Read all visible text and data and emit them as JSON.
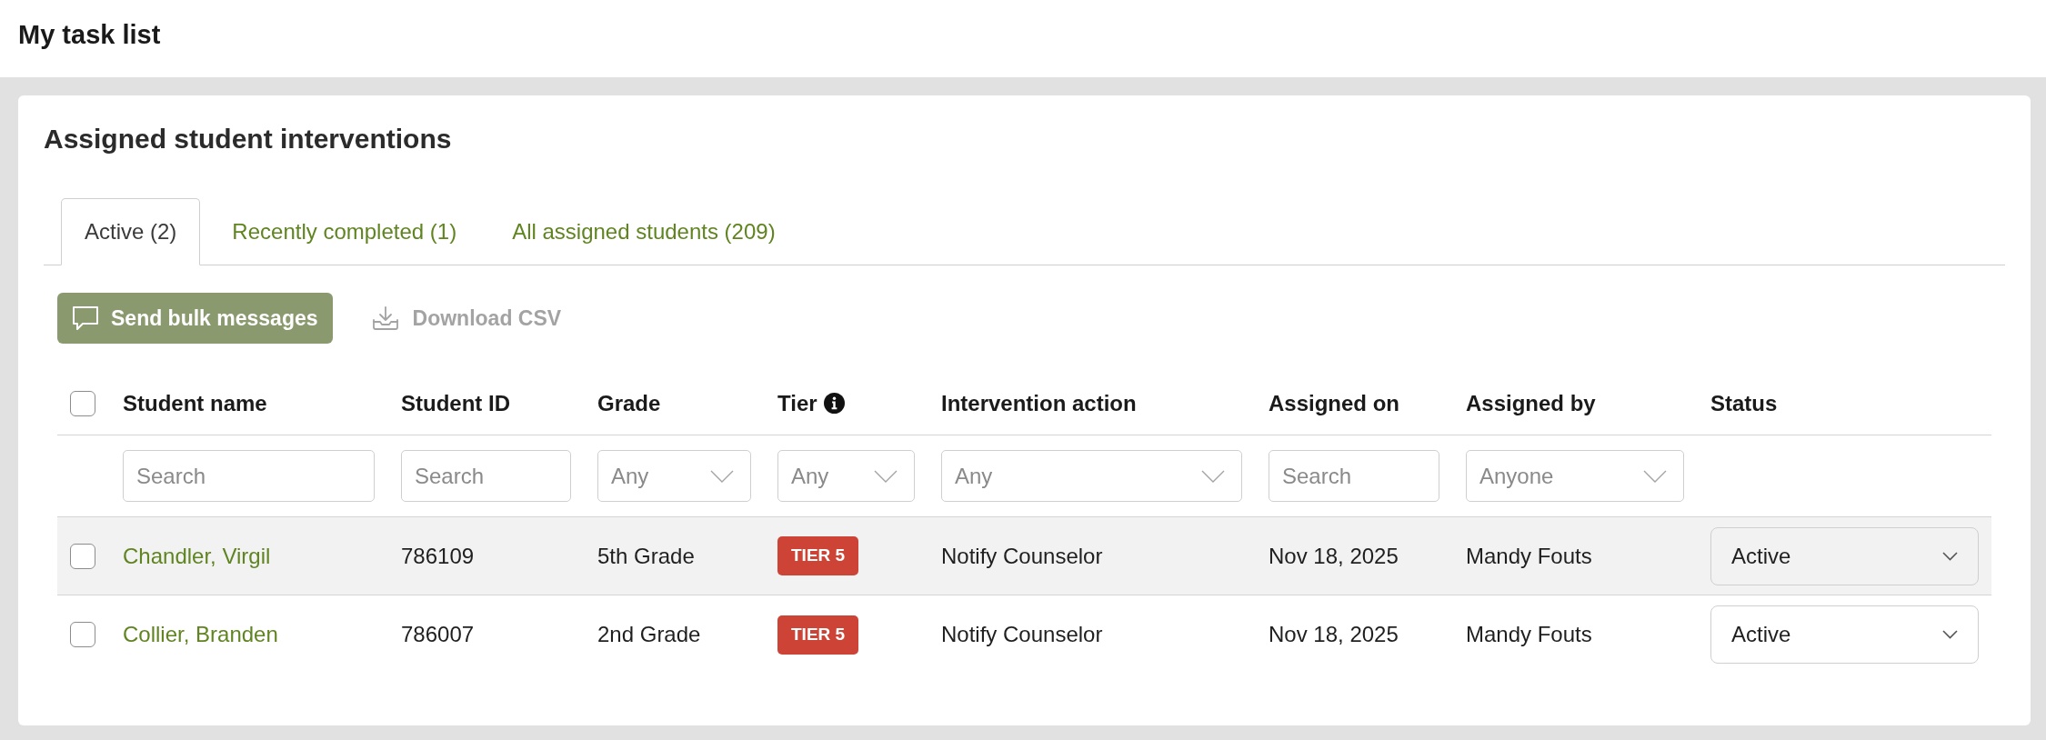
{
  "header": {
    "title": "My task list"
  },
  "card": {
    "title": "Assigned student interventions"
  },
  "tabs": [
    {
      "label": "Active (2)",
      "selected": true
    },
    {
      "label": "Recently completed (1)",
      "selected": false
    },
    {
      "label": "All assigned students (209)",
      "selected": false
    }
  ],
  "toolbar": [
    {
      "kind": "primary",
      "label": "Send bulk messages",
      "disabled": false
    },
    {
      "kind": "download",
      "label": "Download CSV",
      "disabled": true
    }
  ],
  "table": {
    "select_all": {
      "checked": false
    },
    "columns": [
      {
        "kind": "plain",
        "label": "Student name"
      },
      {
        "kind": "plain",
        "label": "Student ID"
      },
      {
        "kind": "plain",
        "label": "Grade"
      },
      {
        "kind": "with_info",
        "label": "Tier"
      },
      {
        "kind": "plain",
        "label": "Intervention action"
      },
      {
        "kind": "plain",
        "label": "Assigned on"
      },
      {
        "kind": "plain",
        "label": "Assigned by"
      },
      {
        "kind": "plain",
        "label": "Status"
      }
    ],
    "filters": [
      {
        "kind": "search",
        "placeholder": "Search"
      },
      {
        "kind": "search",
        "placeholder": "Search"
      },
      {
        "kind": "select",
        "placeholder": "Any"
      },
      {
        "kind": "select",
        "placeholder": "Any"
      },
      {
        "kind": "select",
        "placeholder": "Any"
      },
      {
        "kind": "search",
        "placeholder": "Search"
      },
      {
        "kind": "select",
        "placeholder": "Anyone"
      }
    ],
    "rows": [
      {
        "checked": false,
        "hovered": true,
        "name": "Chandler, Virgil",
        "student_id": "786109",
        "grade": "5th Grade",
        "tier": {
          "label": "TIER 5",
          "color": "#cd4436"
        },
        "action": "Notify Counselor",
        "assigned_on": "Nov 18, 2025",
        "assigned_by": "Mandy Fouts",
        "status": "Active"
      },
      {
        "checked": false,
        "hovered": false,
        "name": "Collier, Branden",
        "student_id": "786007",
        "grade": "2nd Grade",
        "tier": {
          "label": "TIER 5",
          "color": "#cd4436"
        },
        "action": "Notify Counselor",
        "assigned_on": "Nov 18, 2025",
        "assigned_by": "Mandy Fouts",
        "status": "Active"
      }
    ]
  }
}
